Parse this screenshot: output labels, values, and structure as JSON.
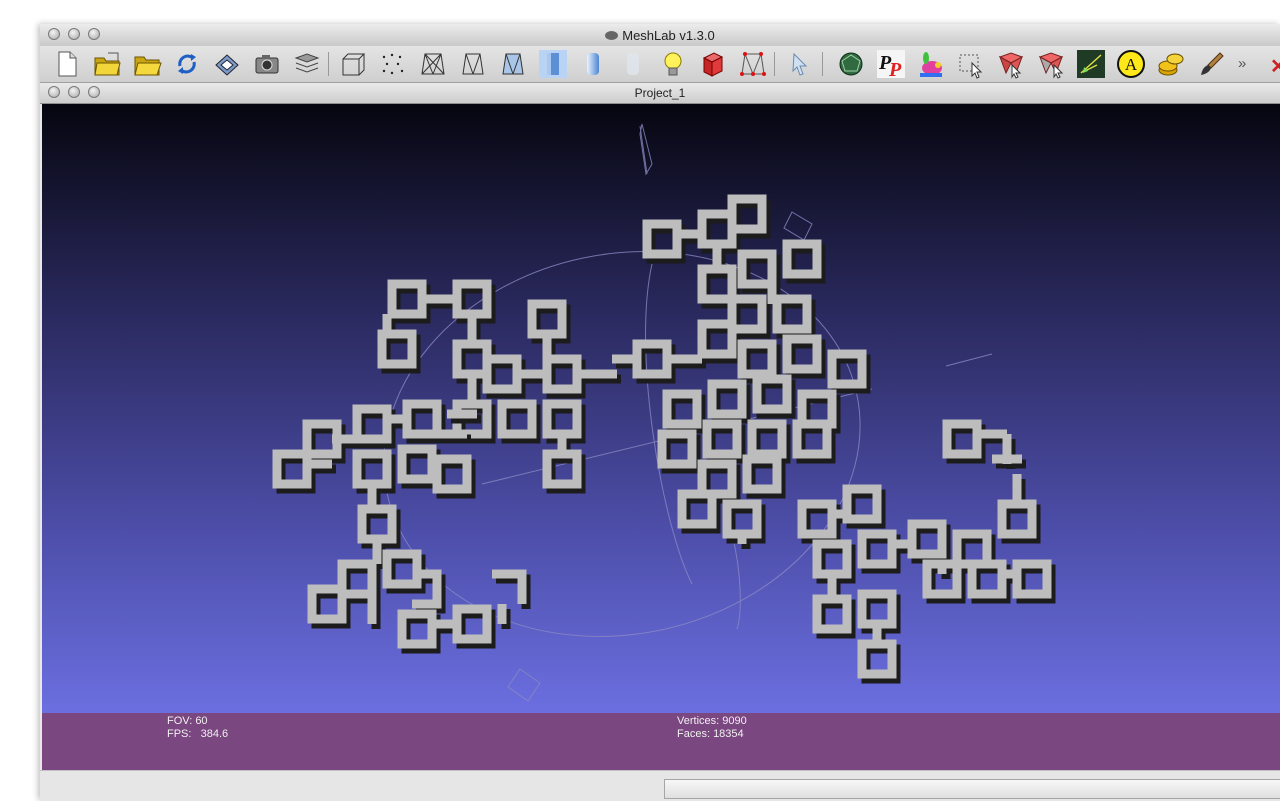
{
  "window": {
    "title": "MeshLab v1.3.0",
    "title_icon": "meshlab-eye-icon"
  },
  "toolbar": {
    "buttons": [
      {
        "name": "new-project-button",
        "icon": "blank-page-icon"
      },
      {
        "name": "open-project-button",
        "icon": "layers-folder-icon"
      },
      {
        "name": "open-mesh-button",
        "icon": "open-folder-icon"
      },
      {
        "name": "reload-button",
        "icon": "circular-arrows-icon"
      },
      {
        "name": "save-button",
        "icon": "floppy-disk-icon"
      },
      {
        "name": "snapshot-button",
        "icon": "camera-icon"
      },
      {
        "name": "layers-button",
        "icon": "stacked-layers-icon"
      },
      {
        "name": "bounding-box-button",
        "icon": "wire-cube-icon"
      },
      {
        "name": "points-button",
        "icon": "dotted-points-icon"
      },
      {
        "name": "wireframe-button",
        "icon": "wireframe-icon"
      },
      {
        "name": "hidden-lines-button",
        "icon": "hidden-lines-icon"
      },
      {
        "name": "flat-lines-button",
        "icon": "flat-lines-icon"
      },
      {
        "name": "flat-button",
        "icon": "flat-shading-icon"
      },
      {
        "name": "smooth-button",
        "icon": "smooth-shading-icon"
      },
      {
        "name": "texture-button",
        "icon": "texture-icon"
      },
      {
        "name": "light-button",
        "icon": "light-bulb-icon"
      },
      {
        "name": "backface-button",
        "icon": "red-box-icon"
      },
      {
        "name": "select-vertices-button",
        "icon": "selected-vertices-icon"
      },
      {
        "name": "pointer-button",
        "icon": "pointer-icon"
      },
      {
        "name": "rasterize-button",
        "icon": "green-sphere-icon"
      },
      {
        "name": "pick-points-button",
        "icon": "pp-icon"
      },
      {
        "name": "paint-bunny-button",
        "icon": "bunny-icon"
      },
      {
        "name": "select-region-button",
        "icon": "select-region-icon"
      },
      {
        "name": "select-faces-button",
        "icon": "select-faces-icon"
      },
      {
        "name": "select-connected-button",
        "icon": "select-connected-icon"
      },
      {
        "name": "measure-button",
        "icon": "measure-icon"
      },
      {
        "name": "align-button",
        "icon": "align-a-icon"
      },
      {
        "name": "coins-button",
        "icon": "coins-icon"
      },
      {
        "name": "paint-brush-button",
        "icon": "paint-brush-icon"
      }
    ],
    "overflow_label": "»"
  },
  "subwindow": {
    "title": "Project_1"
  },
  "viewport": {
    "background_top": "#060610",
    "background_bottom": "#6b6fe0",
    "mesh_color": "#b5b5b5"
  },
  "info": {
    "fov": "FOV: 60",
    "fps": "FPS:   384.6",
    "vertices": "Vertices: 9090",
    "faces": "Faces: 18354",
    "bar_color": "#7a4780"
  }
}
